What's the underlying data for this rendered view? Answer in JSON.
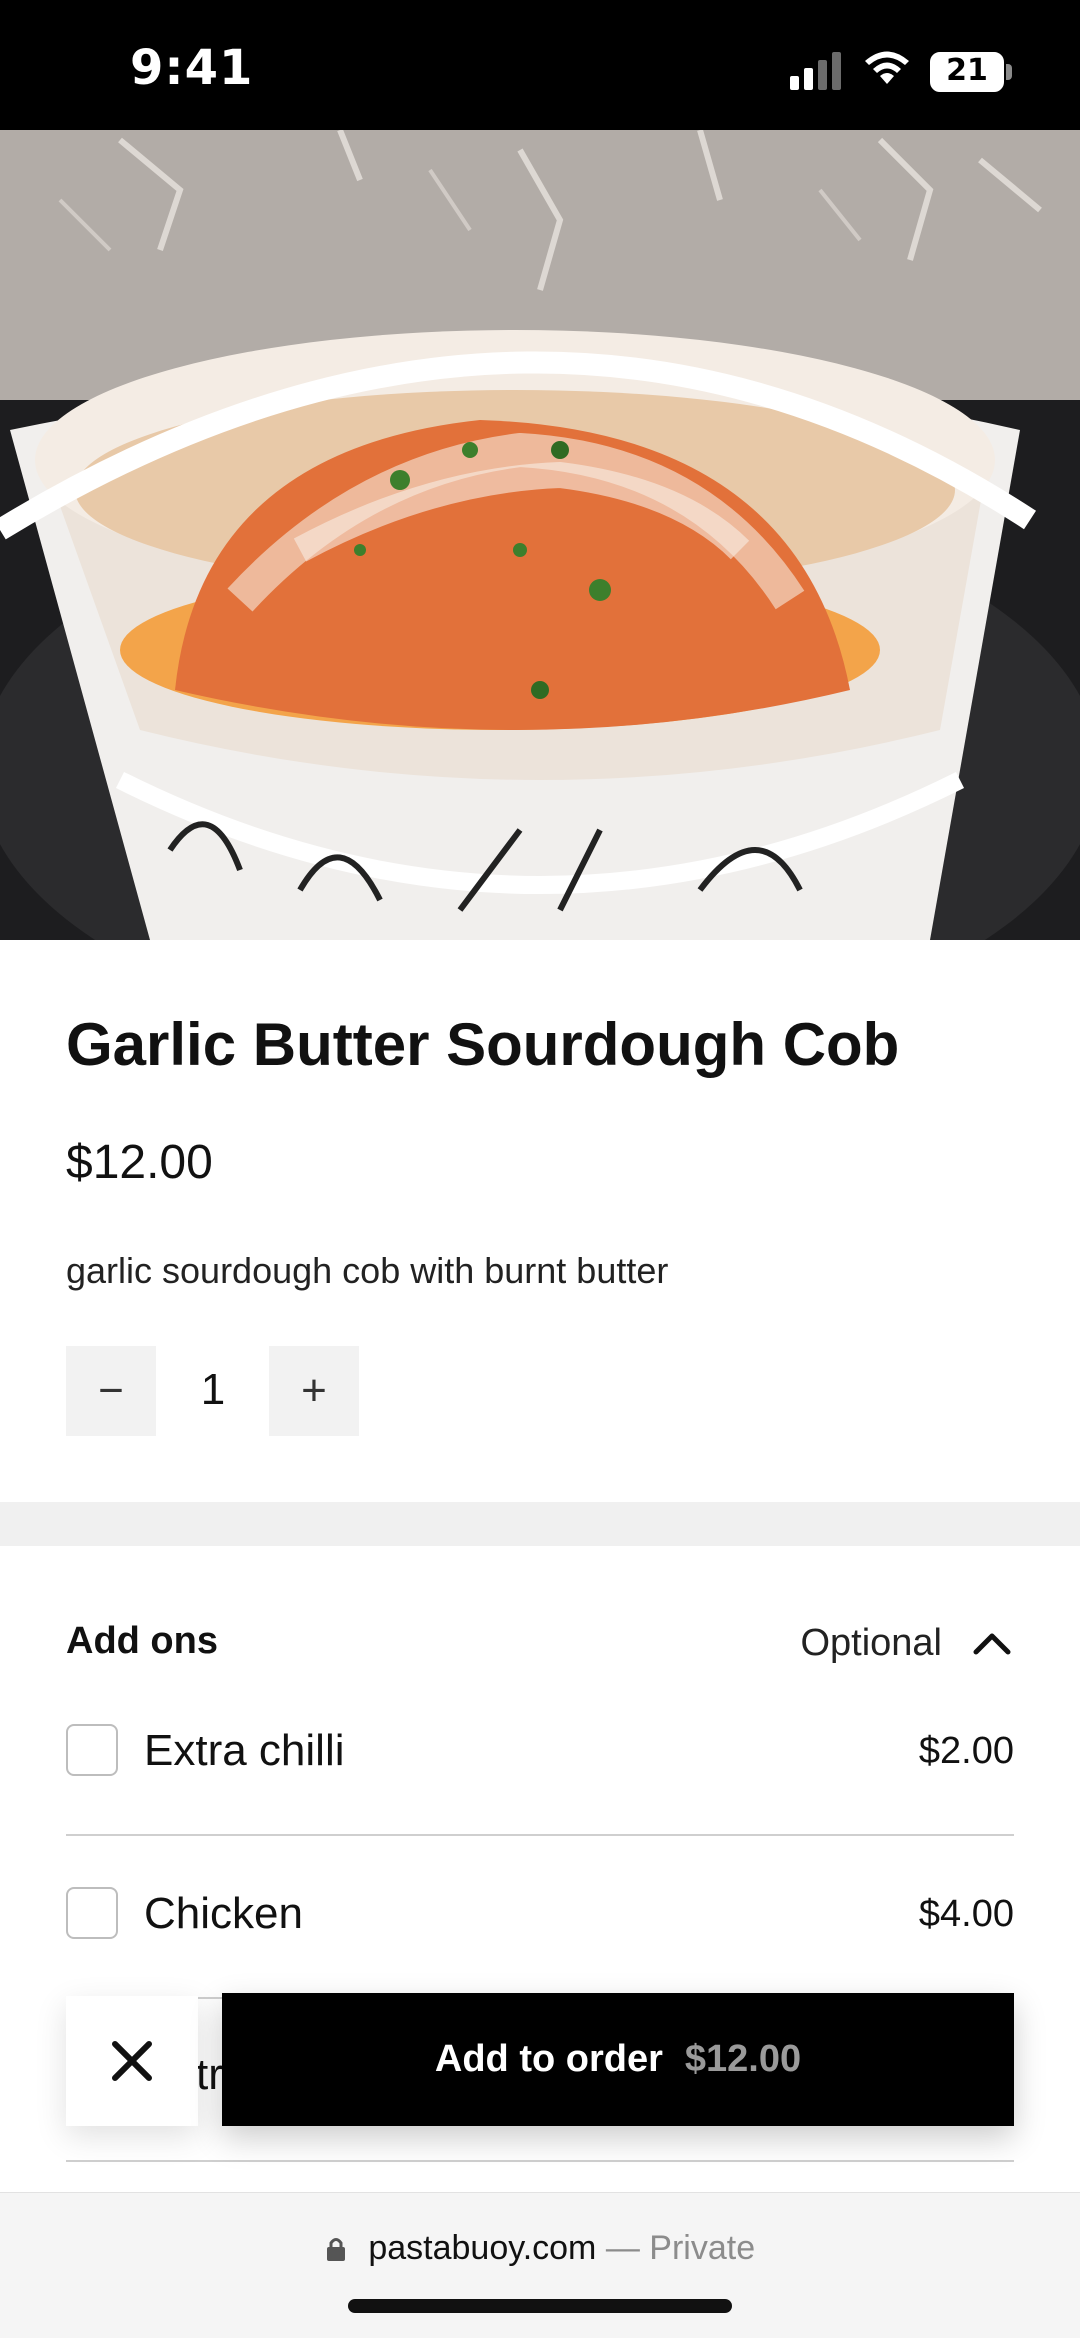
{
  "status_bar": {
    "time": "9:41",
    "battery": "21"
  },
  "product": {
    "title": "Garlic Butter Sourdough Cob",
    "price": "$12.00",
    "description": "garlic sourdough cob with burnt butter",
    "quantity": "1",
    "minus_label": "−",
    "plus_label": "+"
  },
  "addons": {
    "title": "Add ons",
    "optional_label": "Optional",
    "items": [
      {
        "label": "Extra chilli",
        "price": "$2.00"
      },
      {
        "label": "Chicken",
        "price": "$4.00"
      },
      {
        "label": "tr",
        "price": ""
      }
    ]
  },
  "actions": {
    "close_label": "✕",
    "add_to_order_label": "Add to order",
    "add_to_order_price": "$12.00"
  },
  "browser": {
    "domain": "pastabuoy.com",
    "private_label": " — Private"
  },
  "icons": [
    "signal-icon",
    "wifi-icon",
    "battery-icon",
    "chevron-up-icon",
    "close-icon",
    "lock-icon"
  ]
}
